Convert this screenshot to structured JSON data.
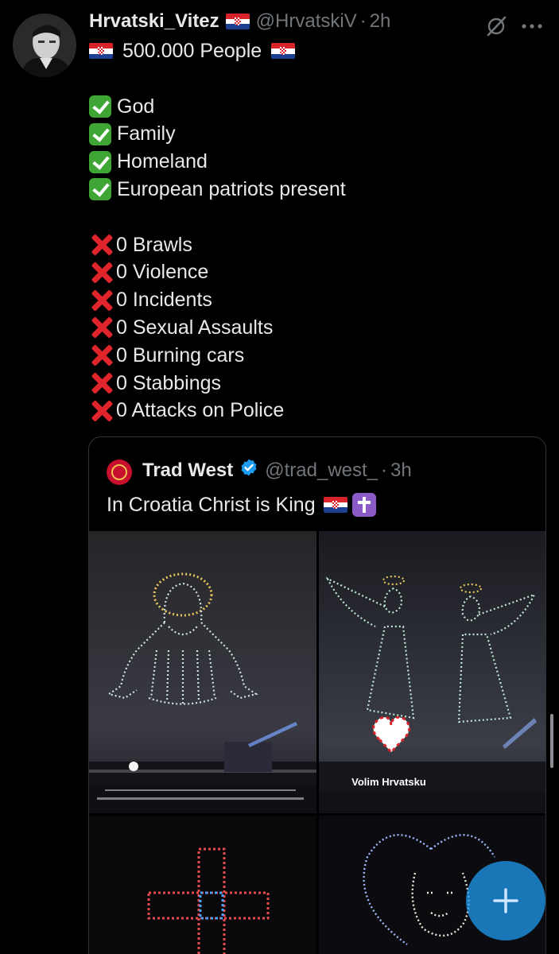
{
  "tweet": {
    "author_name": "Hrvatski_Vitez",
    "handle": "@HrvatskiV",
    "separator": "·",
    "time": "2h",
    "headline": "500.000 People",
    "checks": [
      "God",
      "Family",
      "Homeland",
      "European patriots present"
    ],
    "crosses": [
      "0 Brawls",
      "0 Violence",
      "0 Incidents",
      "0 Sexual Assaults",
      "0 Burning cars",
      "0 Stabbings",
      "0 Attacks on Police"
    ]
  },
  "quote": {
    "author_name": "Trad West",
    "handle": "@trad_west_",
    "separator": "·",
    "time": "3h",
    "text": "In Croatia Christ is King",
    "media": {
      "banner_text": "Volim Hrvatsku"
    }
  },
  "icons": {
    "grok": "grok-icon",
    "more": "more-icon",
    "verified": "verified-badge-icon",
    "compose": "plus-icon"
  },
  "colors": {
    "background": "#000000",
    "text": "#e7e9ea",
    "secondary_text": "#71767b",
    "accent": "#1d9bf0",
    "check_green": "#3fa535",
    "cross_red": "#e0242b"
  }
}
